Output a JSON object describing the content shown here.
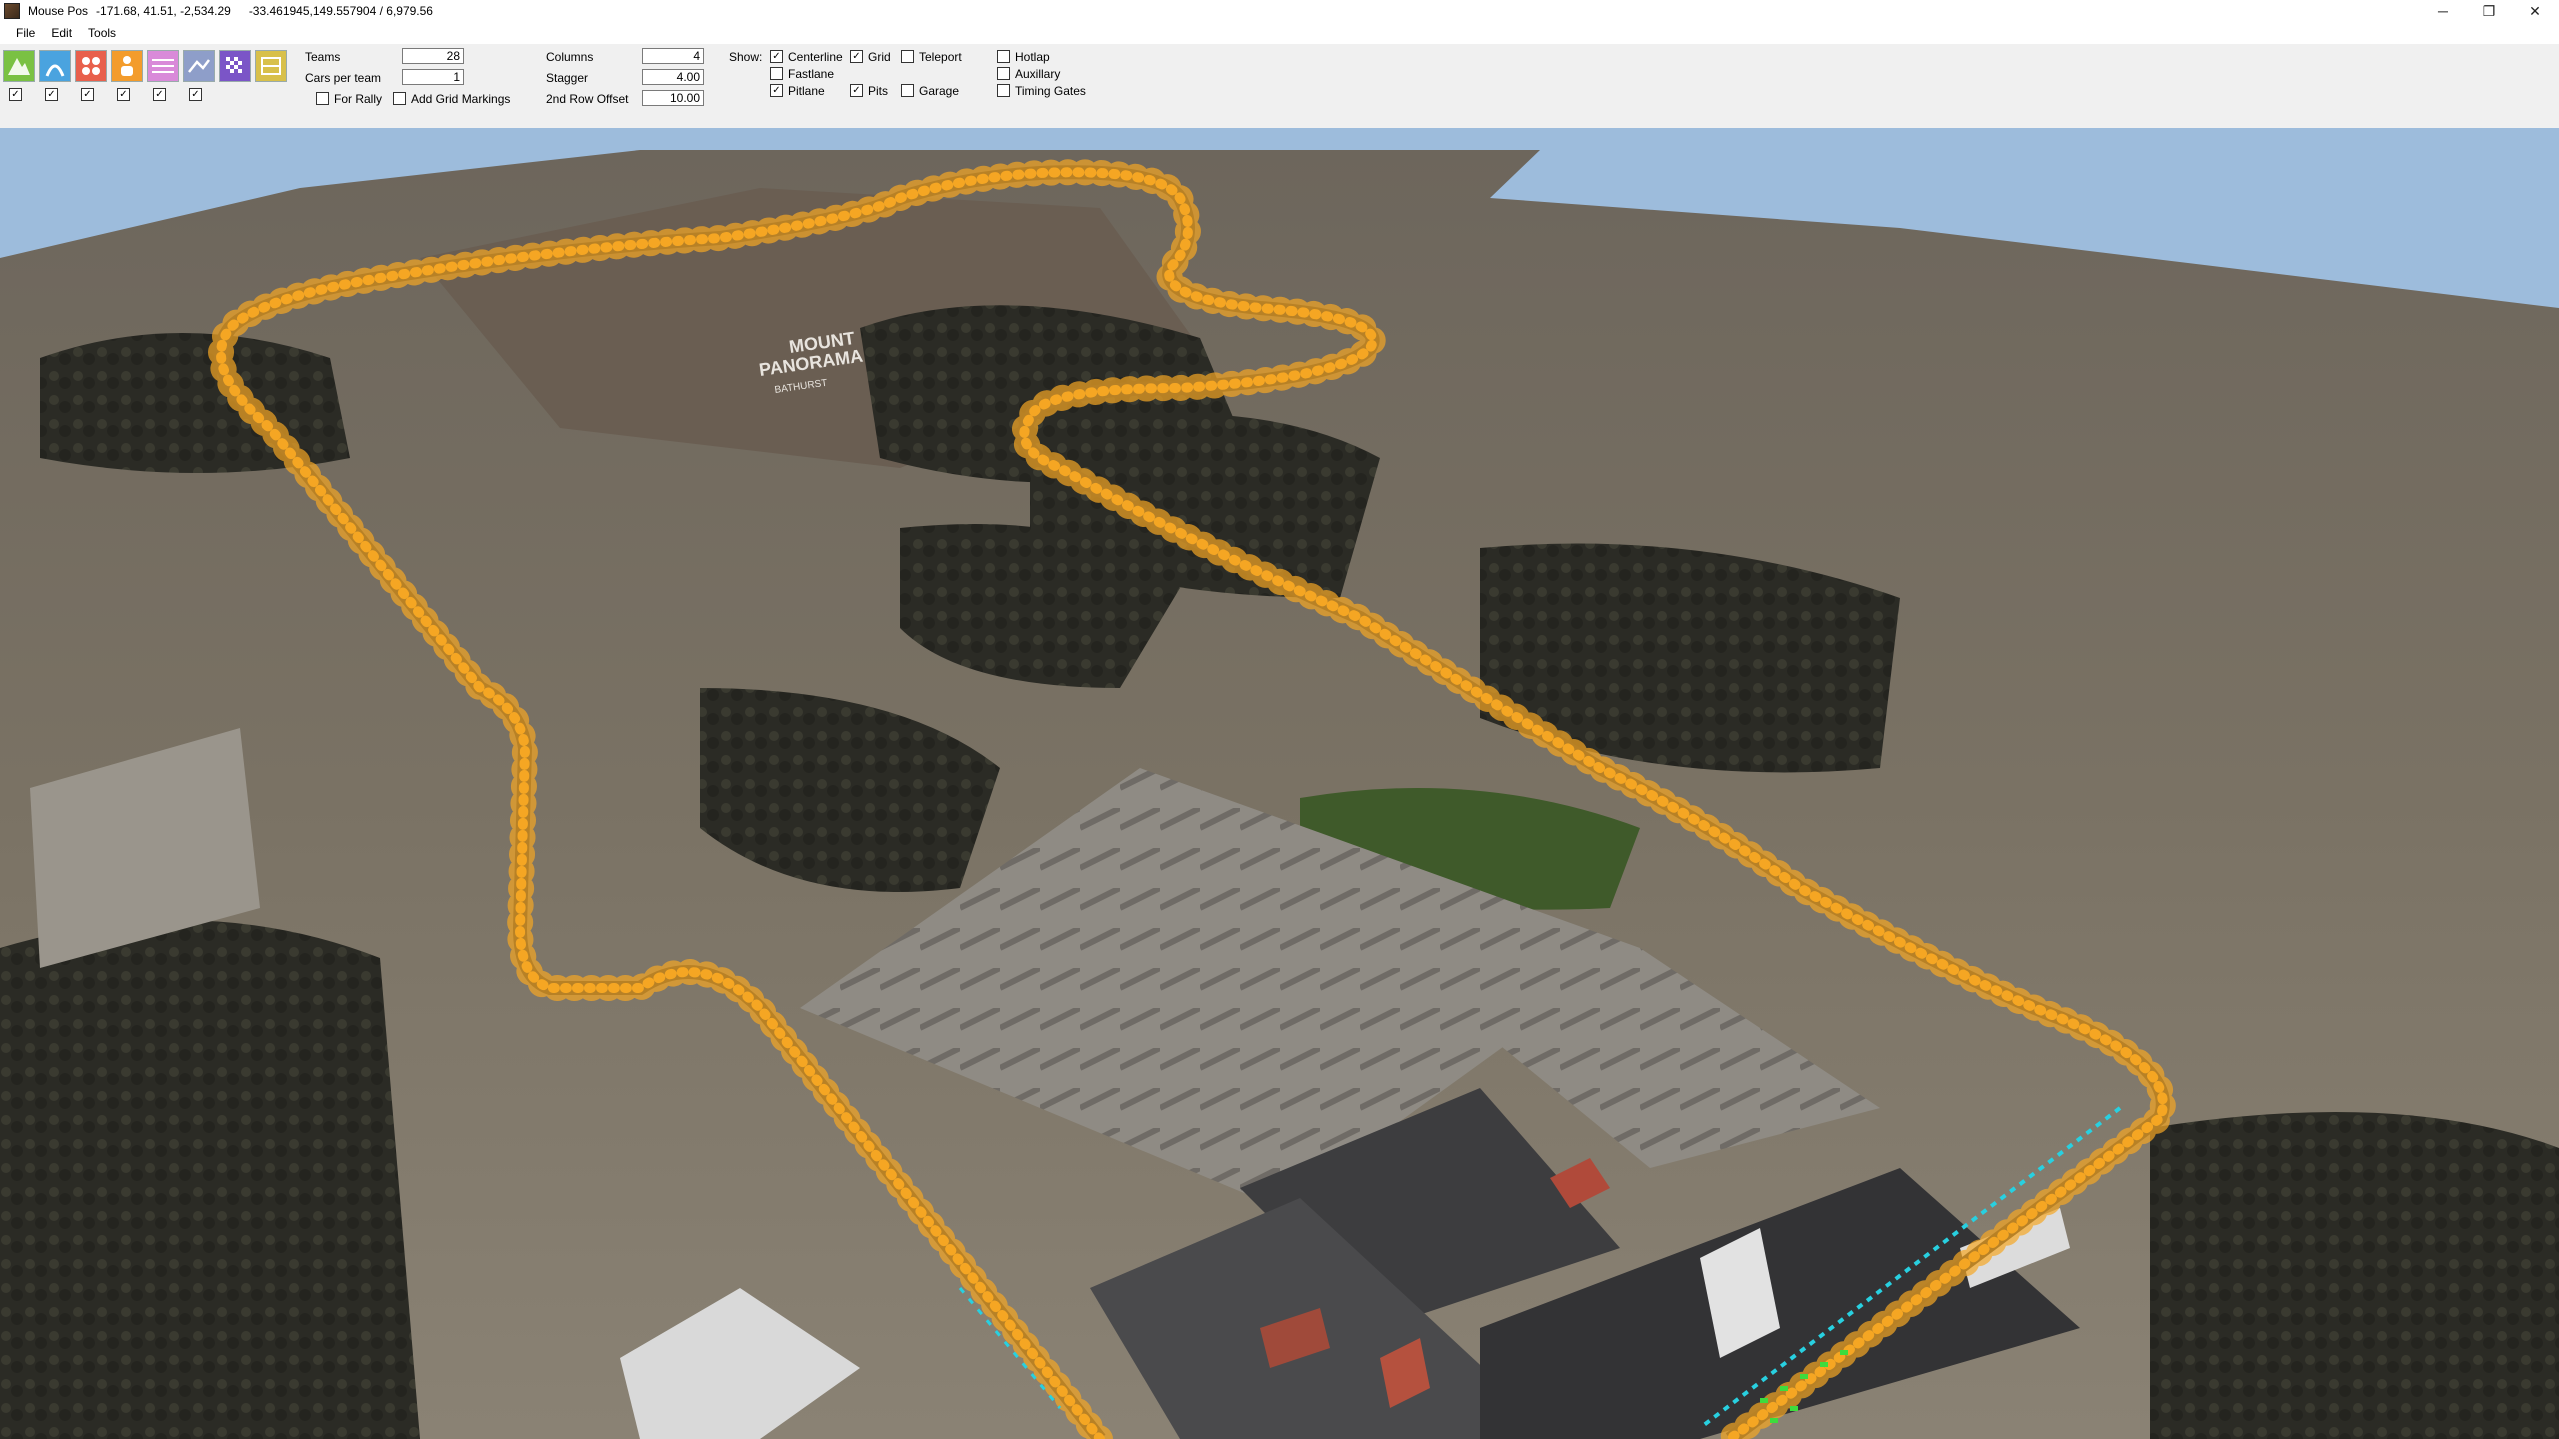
{
  "window": {
    "title": "Mouse Pos",
    "mouse_pos": "-171.68, 41.51, -2,534.29",
    "geo_info": "-33.461945,149.557904 / 6,979.56",
    "controls": {
      "minimize": "─",
      "maximize": "❐",
      "close": "✕"
    }
  },
  "menu": {
    "file": "File",
    "edit": "Edit",
    "tools": "Tools"
  },
  "tools": [
    {
      "icon": "mountain-icon",
      "color": "#7ac143"
    },
    {
      "icon": "road-icon",
      "color": "#4aa3df"
    },
    {
      "icon": "cars-icon",
      "color": "#e8604c"
    },
    {
      "icon": "person-icon",
      "color": "#f39c2c"
    },
    {
      "icon": "grid-icon",
      "color": "#d98ad9"
    },
    {
      "icon": "pit-icon",
      "color": "#8e9ec9"
    },
    {
      "icon": "flag-icon",
      "color": "#7b55c7"
    },
    {
      "icon": "gate-icon",
      "color": "#d8c04a"
    }
  ],
  "tool_checks": [
    true,
    true,
    true,
    true,
    true,
    true
  ],
  "grid": {
    "teams_label": "Teams",
    "teams_value": "28",
    "cars_label": "Cars per team",
    "cars_value": "1",
    "for_rally_label": "For Rally",
    "add_markings_label": "Add Grid Markings",
    "columns_label": "Columns",
    "columns_value": "4",
    "stagger_label": "Stagger",
    "stagger_value": "4.00",
    "row_offset_label": "2nd Row Offset",
    "row_offset_value": "10.00"
  },
  "show": {
    "label": "Show:",
    "centerline": "Centerline",
    "grid": "Grid",
    "teleport": "Teleport",
    "hotlap": "Hotlap",
    "fastlane": "Fastlane",
    "auxillary": "Auxillary",
    "pitlane": "Pitlane",
    "pits": "Pits",
    "garage": "Garage",
    "timing_gates": "Timing Gates"
  },
  "map": {
    "label_line1": "MOUNT",
    "label_line2": "PANORAMA",
    "label_line3": "BATHURST"
  },
  "colors": {
    "track_marker": "#f5a623",
    "pitlane_marker": "#28d0e0",
    "pits_marker": "#3ddc3d",
    "sky": "#9dbcdc"
  }
}
